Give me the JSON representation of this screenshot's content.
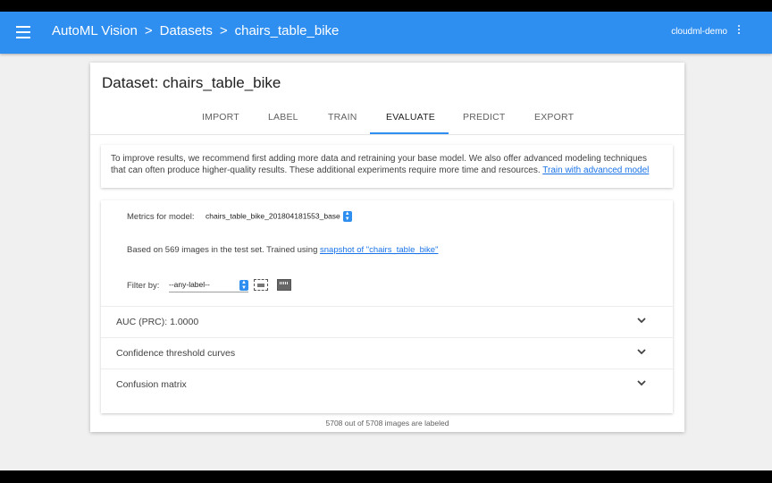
{
  "appbar": {
    "breadcrumbs": [
      "AutoML Vision",
      "Datasets",
      "chairs_table_bike"
    ],
    "separator": ">",
    "user": "cloudml-demo",
    "accent_color": "#2f8ff0"
  },
  "dataset": {
    "title": "Dataset: chairs_table_bike"
  },
  "tabs": [
    {
      "label": "IMPORT",
      "active": false
    },
    {
      "label": "LABEL",
      "active": false
    },
    {
      "label": "TRAIN",
      "active": false
    },
    {
      "label": "EVALUATE",
      "active": true
    },
    {
      "label": "PREDICT",
      "active": false
    },
    {
      "label": "EXPORT",
      "active": false
    }
  ],
  "banner": {
    "text": "To improve results, we recommend first adding more data and retraining your base model. We also offer advanced modeling techniques that can often produce higher-quality results. These additional experiments require more time and resources.",
    "link": "Train with advanced model"
  },
  "evaluate": {
    "metrics_label": "Metrics for model:",
    "model_value": "chairs_table_bike_201804181553_base",
    "info_prefix": "Based on 569 images in the test set. Trained using",
    "info_link": "snapshot of \"chairs_table_bike\"",
    "filter_label": "Filter by:",
    "filter_value": "--any-label--",
    "sections": [
      {
        "label": "AUC (PRC): 1.0000"
      },
      {
        "label": "Confidence threshold curves"
      },
      {
        "label": "Confusion matrix"
      }
    ]
  },
  "footer": {
    "status": "5708 out of 5708 images are labeled"
  },
  "icons": {
    "menu": "menu-icon",
    "more": "more-vert-icon",
    "expand": "chevron-down-icon"
  }
}
